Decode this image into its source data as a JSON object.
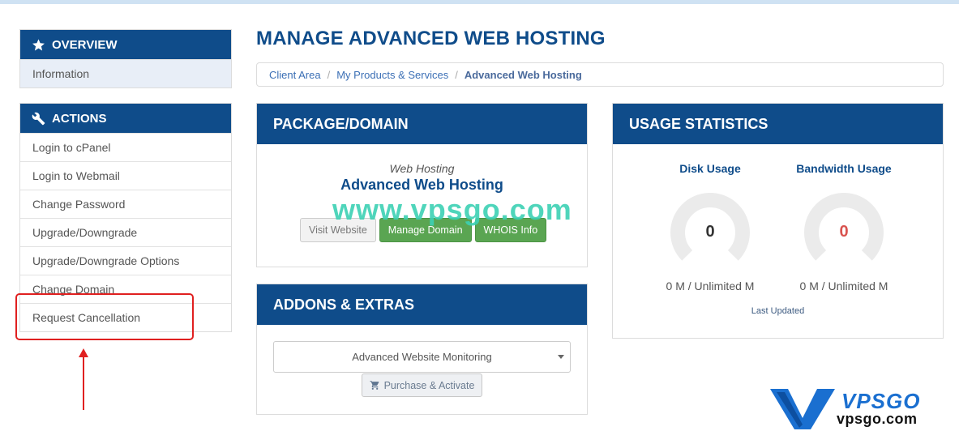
{
  "sidebar": {
    "overview": {
      "title": "OVERVIEW",
      "items": [
        "Information"
      ]
    },
    "actions": {
      "title": "ACTIONS",
      "items": [
        "Login to cPanel",
        "Login to Webmail",
        "Change Password",
        "Upgrade/Downgrade",
        "Upgrade/Downgrade Options",
        "Change Domain",
        "Request Cancellation"
      ]
    }
  },
  "main": {
    "title": "MANAGE ADVANCED WEB HOSTING",
    "breadcrumb": [
      "Client Area",
      "My Products & Services",
      "Advanced Web Hosting"
    ],
    "package": {
      "header": "PACKAGE/DOMAIN",
      "type": "Web Hosting",
      "name": "Advanced Web Hosting",
      "buttons": {
        "visit": "Visit Website",
        "manage": "Manage Domain",
        "whois": "WHOIS Info"
      }
    },
    "addons": {
      "header": "ADDONS & EXTRAS",
      "selected": "Advanced Website Monitoring",
      "purchase": "Purchase & Activate"
    },
    "usage": {
      "header": "USAGE STATISTICS",
      "disk": {
        "label": "Disk Usage",
        "value": "0",
        "text": "0 M / Unlimited M"
      },
      "bandwidth": {
        "label": "Bandwidth Usage",
        "value": "0",
        "text": "0 M / Unlimited M"
      },
      "last_updated": "Last Updated"
    }
  },
  "watermark": "www.vpsgo.com",
  "logo": {
    "name": "VPSGO",
    "url": "vpsgo.com"
  },
  "colors": {
    "primary": "#0f4c8a",
    "success": "#5aa552",
    "highlight": "#e02020",
    "gauge_track": "#ebebeb",
    "bandwidth_value": "#d9534f"
  }
}
